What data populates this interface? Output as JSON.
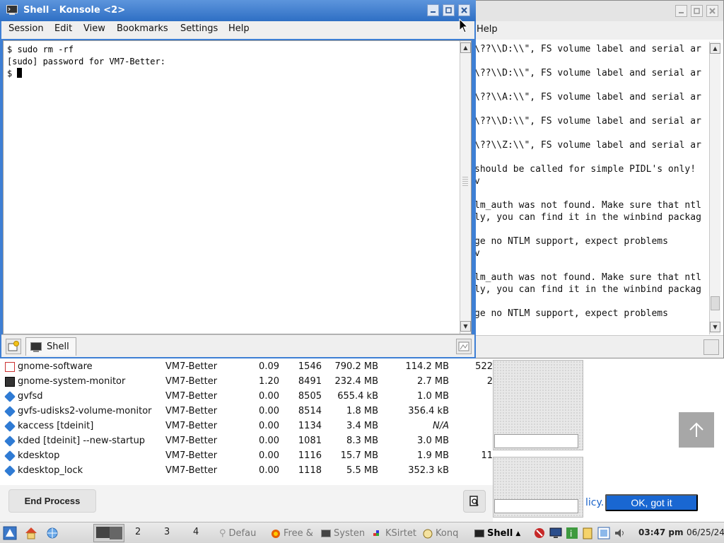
{
  "colors": {
    "titlebar_active": "#3e7fd4",
    "ok_button": "#1967d2",
    "link": "#1a63c9"
  },
  "konsole": {
    "title": "Shell - Konsole <2>",
    "menu": [
      "Session",
      "Edit",
      "View",
      "Bookmarks",
      "Settings",
      "Help"
    ],
    "terminal_lines": [
      "$ sudo rm -rf",
      "[sudo] password for VM7-Better:",
      "$ "
    ],
    "tab_label": "Shell",
    "icons": {
      "app": "terminal-icon",
      "new_tab": "new-tab-icon",
      "close_tab": "close-tab-icon"
    }
  },
  "konsole_back": {
    "menu_help": "Help",
    "terminal_lines": [
      "\\??\\\\D:\\\\\", FS volume label and serial ar",
      "",
      "\\??\\\\D:\\\\\", FS volume label and serial ar",
      "",
      "\\??\\\\A:\\\\\", FS volume label and serial ar",
      "",
      "\\??\\\\D:\\\\\", FS volume label and serial ar",
      "",
      "\\??\\\\Z:\\\\\", FS volume label and serial ar",
      "",
      "should be called for simple PIDL's only!",
      "v",
      "",
      "lm_auth was not found. Make sure that ntl",
      "ly, you can find it in the winbind packag",
      "",
      "ge no NTLM support, expect problems",
      "v",
      "",
      "lm_auth was not found. Make sure that ntl",
      "ly, you can find it in the winbind packag",
      "",
      "ge no NTLM support, expect problems"
    ]
  },
  "processes": [
    {
      "name": "gnome-software",
      "user": "VM7-Better",
      "cpu": "0.09",
      "id": "1546",
      "memory": "790.2 MB",
      "resident": "114.2 MB",
      "extra": "522",
      "icon": "software-icon"
    },
    {
      "name": "gnome-system-monitor",
      "user": "VM7-Better",
      "cpu": "1.20",
      "id": "8491",
      "memory": "232.4 MB",
      "resident": "2.7 MB",
      "extra": "2",
      "icon": "monitor-icon"
    },
    {
      "name": "gvfsd",
      "user": "VM7-Better",
      "cpu": "0.00",
      "id": "8505",
      "memory": "655.4 kB",
      "resident": "1.0 MB",
      "extra": "",
      "icon": "process-icon"
    },
    {
      "name": "gvfs-udisks2-volume-monitor",
      "user": "VM7-Better",
      "cpu": "0.00",
      "id": "8514",
      "memory": "1.8 MB",
      "resident": "356.4 kB",
      "extra": "",
      "icon": "process-icon"
    },
    {
      "name": "kaccess [tdeinit]",
      "user": "VM7-Better",
      "cpu": "0.00",
      "id": "1134",
      "memory": "3.4 MB",
      "resident": "N/A",
      "extra": "",
      "icon": "process-icon"
    },
    {
      "name": "kded [tdeinit] --new-startup",
      "user": "VM7-Better",
      "cpu": "0.00",
      "id": "1081",
      "memory": "8.3 MB",
      "resident": "3.0 MB",
      "extra": "",
      "icon": "process-icon"
    },
    {
      "name": "kdesktop",
      "user": "VM7-Better",
      "cpu": "0.00",
      "id": "1116",
      "memory": "15.7 MB",
      "resident": "1.9 MB",
      "extra": "11",
      "icon": "process-icon"
    },
    {
      "name": "kdesktop_lock",
      "user": "VM7-Better",
      "cpu": "0.00",
      "id": "1118",
      "memory": "5.5 MB",
      "resident": "352.3 kB",
      "extra": "",
      "icon": "process-icon"
    }
  ],
  "sysmon": {
    "end_process": "End Process"
  },
  "web": {
    "policy_text": "licy.",
    "ok_button": "OK, got it"
  },
  "taskbar": {
    "desktops": [
      "2",
      "3",
      "4"
    ],
    "tasks": [
      {
        "label": "Defau",
        "icon": "pin-icon",
        "active": false
      },
      {
        "label": "Free &",
        "icon": "firefox-icon",
        "active": false
      },
      {
        "label": "Systen",
        "icon": "terminal-icon",
        "active": false
      },
      {
        "label": "KSirtet",
        "icon": "ksirtet-icon",
        "active": false
      },
      {
        "label": "Konq",
        "icon": "konqueror-icon",
        "active": false
      },
      {
        "label": "Shell",
        "icon": "terminal-icon",
        "active": true
      }
    ],
    "time": "03:47 pm",
    "date": "06/25/24"
  }
}
